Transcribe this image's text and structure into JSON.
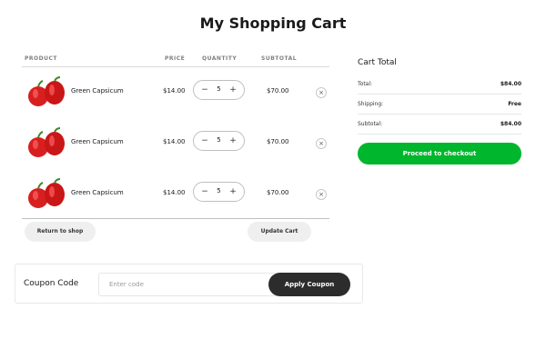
{
  "page": {
    "title": "My Shopping Cart"
  },
  "cart": {
    "columns": {
      "product": "PRODUCT",
      "price": "PRICE",
      "quantity": "QUANTITY",
      "subtotal": "SUBTOTAL"
    },
    "items": [
      {
        "name": "Green Capsicum",
        "price": "$14.00",
        "quantity": "5",
        "subtotal": "$70.00",
        "image_icon": "red-bell-peppers"
      },
      {
        "name": "Green Capsicum",
        "price": "$14.00",
        "quantity": "5",
        "subtotal": "$70.00",
        "image_icon": "red-bell-peppers"
      },
      {
        "name": "Green Capsicum",
        "price": "$14.00",
        "quantity": "5",
        "subtotal": "$70.00",
        "image_icon": "red-bell-peppers"
      }
    ],
    "minus_glyph": "−",
    "plus_glyph": "+",
    "remove_glyph": "×",
    "return_label": "Return to shop",
    "update_label": "Update Cart"
  },
  "totals": {
    "title": "Cart Total",
    "rows": [
      {
        "label": "Total:",
        "value": "$84.00"
      },
      {
        "label": "Shipping:",
        "value": "Free"
      },
      {
        "label": "Subtotal:",
        "value": "$84.00"
      }
    ],
    "checkout_label": "Proceed to checkout"
  },
  "coupon": {
    "label": "Coupon Code",
    "placeholder": "Enter code",
    "value": "",
    "apply_label": "Apply Coupon"
  },
  "colors": {
    "accent": "#00b62d",
    "dark_button": "#2c2c2c",
    "pill_button": "#efefef",
    "pepper_red": "#d81f1f"
  }
}
